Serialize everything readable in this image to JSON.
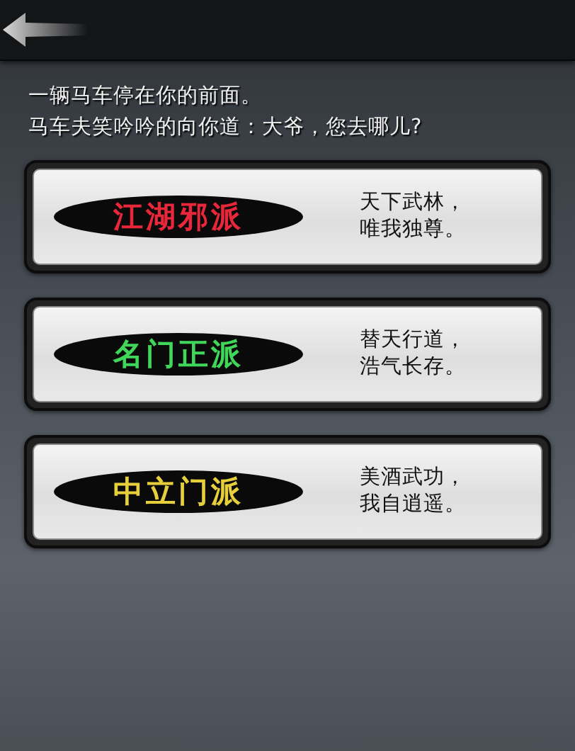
{
  "intro": [
    "一辆马车停在你的前面。",
    "马车夫笑吟吟的向你道：大爷，您去哪儿?"
  ],
  "factions": [
    {
      "name": "江湖邪派",
      "kind": "evil",
      "motto": [
        "天下武林，",
        "唯我独尊。"
      ]
    },
    {
      "name": "名门正派",
      "kind": "righteous",
      "motto": [
        "替天行道，",
        "浩气长存。"
      ]
    },
    {
      "name": "中立门派",
      "kind": "neutral",
      "motto": [
        "美酒武功，",
        "我自逍遥。"
      ]
    }
  ]
}
